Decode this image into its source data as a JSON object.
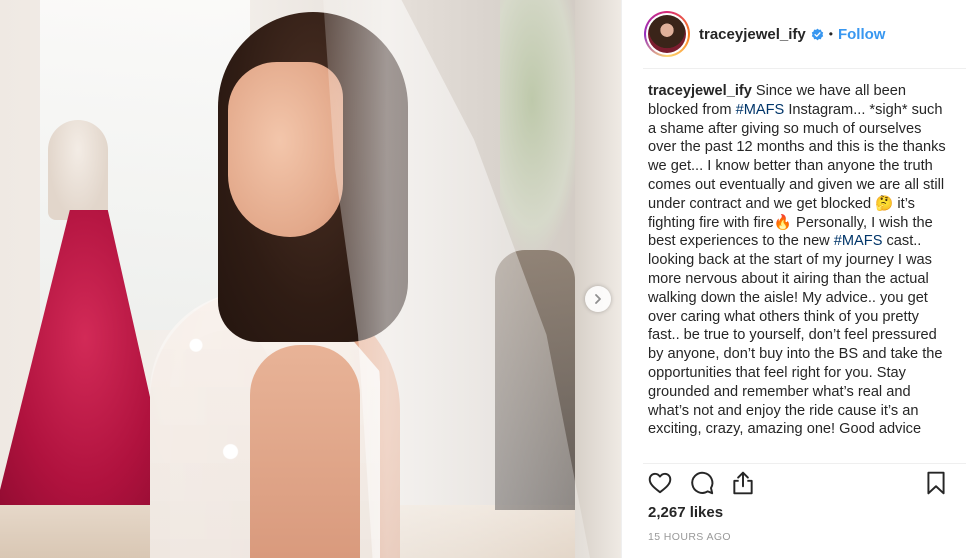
{
  "post": {
    "username": "tracey​jewel_ify",
    "dot": "•",
    "follow_label": "Follow",
    "caption": {
      "username": "traceyjewel_ify",
      "p1": " Since we have all been blocked from ",
      "tag1": "#MAFS",
      "p2": " Instagram... *sigh* such a shame after giving so much of ourselves over the past 12 months and this is the thanks we get... I know better than anyone the truth comes out eventually and given we are all still under contract and we get blocked ",
      "emoji1": "🤔",
      "p3": "  it’s fighting fire with fire",
      "emoji2": "🔥",
      "p4": " Personally, I wish the best experiences to the new ",
      "tag2": "#MAFS",
      "p5": " cast.. looking back at the start of my journey I was more nervous about it airing than the actual walking down the aisle! My advice.. you get over caring what others think of you pretty fast.. be true to yourself, don’t feel pressured by anyone, don’t buy into the BS and take the opportunities that feel right for you. Stay grounded and remember what’s real and what’s not and enjoy the ride cause it’s an exciting, crazy, amazing one! Good advice"
    },
    "likes": "2,267 likes",
    "time": "15 HOURS AGO"
  },
  "icons": {
    "verified": "verified-badge-icon",
    "like": "heart-icon",
    "comment": "comment-icon",
    "share": "share-icon",
    "save": "bookmark-icon",
    "next": "chevron-right-icon"
  },
  "colors": {
    "accent": "#3897f0",
    "hashtag": "#003569",
    "text": "#262626",
    "muted": "#999999"
  }
}
